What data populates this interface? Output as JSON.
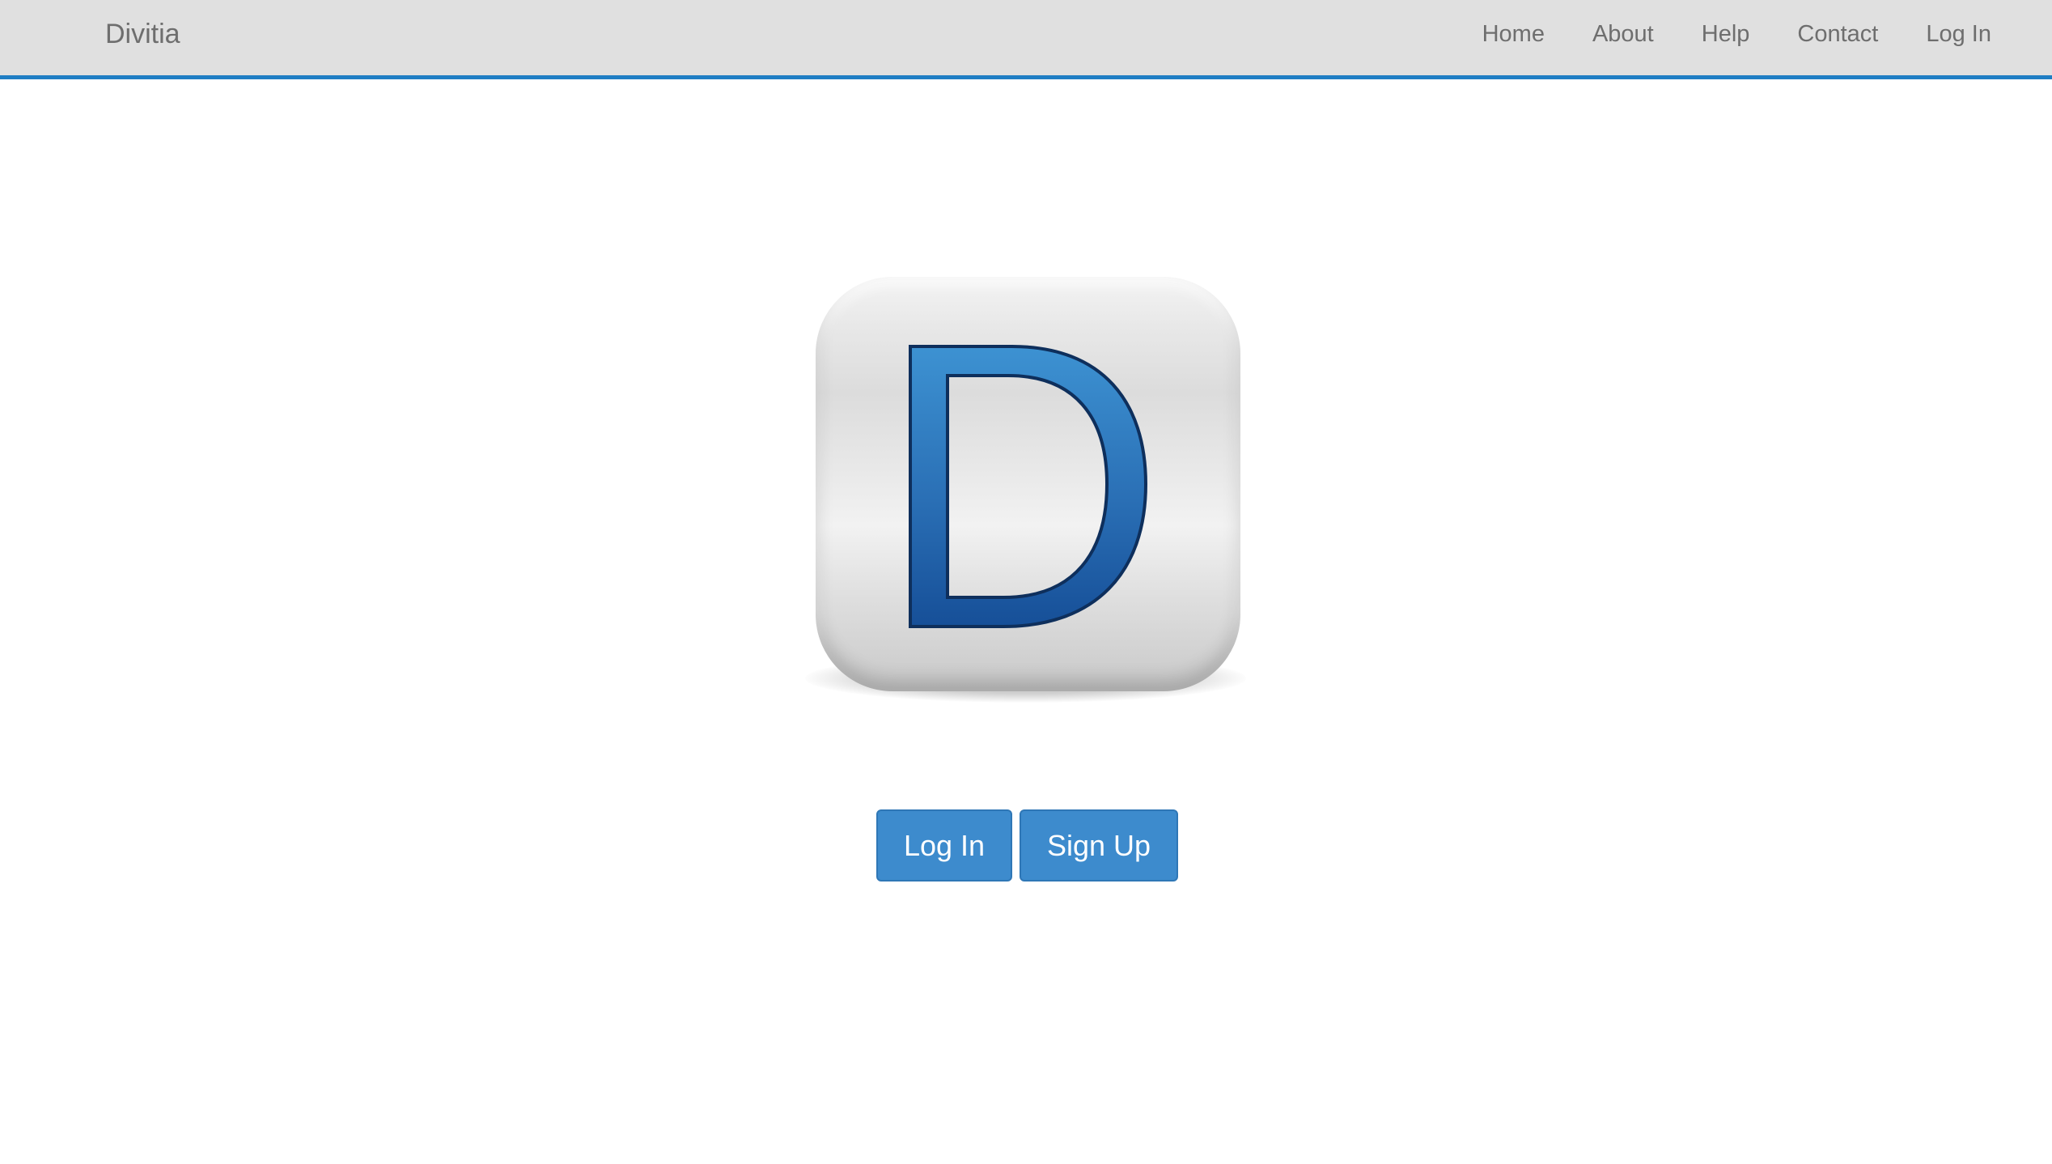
{
  "navbar": {
    "brand": "Divitia",
    "items": [
      {
        "label": "Home"
      },
      {
        "label": "About"
      },
      {
        "label": "Help"
      },
      {
        "label": "Contact"
      },
      {
        "label": "Log In"
      }
    ],
    "accent_color": "#1f7ec4",
    "background_color": "#e0e0e0"
  },
  "logo": {
    "icon": "divitia-d-logo",
    "letter": "D",
    "letter_color": "#2a72b8"
  },
  "actions": {
    "login_label": "Log In",
    "signup_label": "Sign Up",
    "button_color": "#3d8bcd"
  }
}
